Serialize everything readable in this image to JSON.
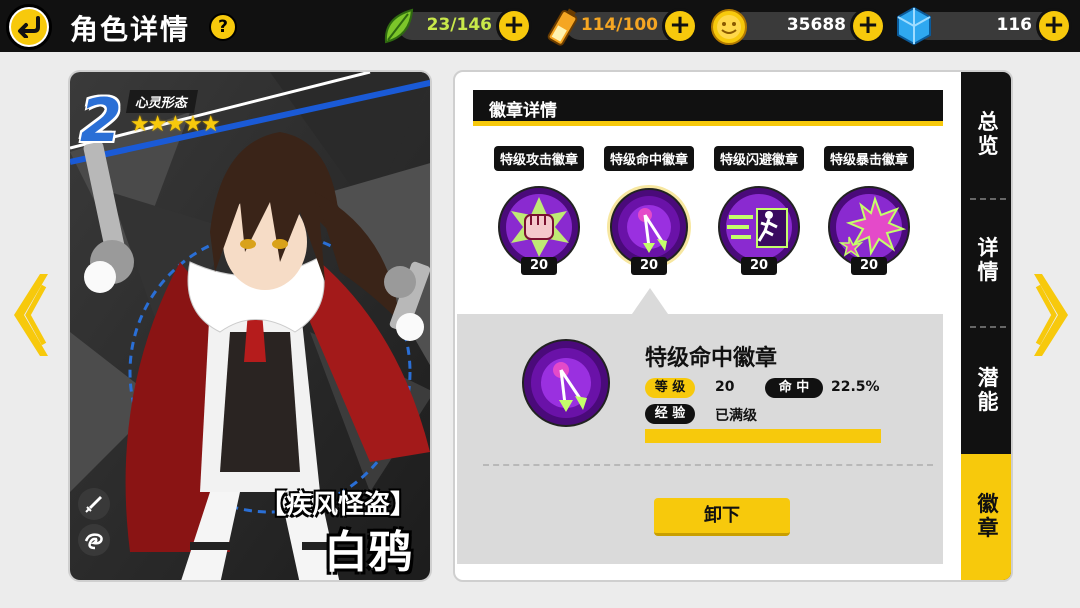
{
  "header": {
    "title": "角色详情",
    "help_label": "?",
    "resources": [
      {
        "icon": "leaf-icon",
        "value": "23/146",
        "value_color": "#c9e84a"
      },
      {
        "icon": "battery-icon",
        "value": "114/100",
        "value_color": "#f5a623"
      },
      {
        "icon": "coin-icon",
        "value": "35688",
        "value_color": "#ffffff"
      },
      {
        "icon": "crystal-icon",
        "value": "116",
        "value_color": "#ffffff"
      }
    ],
    "plus_label": "+"
  },
  "character": {
    "rank": "2",
    "form_label": "心灵形态",
    "stars": "★★★★★",
    "star_count": 5,
    "title": "【疾风怪盗】",
    "name": "白鸦"
  },
  "badge_panel": {
    "header": "徽章详情",
    "badges": [
      {
        "label": "特级攻击徽章",
        "level": "20",
        "icon": "fist-icon"
      },
      {
        "label": "特级命中徽章",
        "level": "20",
        "icon": "target-arrow-icon",
        "selected": true
      },
      {
        "label": "特级闪避徽章",
        "level": "20",
        "icon": "running-man-icon"
      },
      {
        "label": "特级暴击徽章",
        "level": "20",
        "icon": "burst-icon"
      }
    ],
    "detail": {
      "name": "特级命中徽章",
      "level_label": "等 级",
      "level_value": "20",
      "stat_label": "命 中",
      "stat_value": "22.5%",
      "exp_label": "经 验",
      "exp_value": "已满级",
      "exp_progress": 1.0
    },
    "unequip_label": "卸下"
  },
  "side_tabs": [
    {
      "label": "总览",
      "active": false
    },
    {
      "label": "详情",
      "active": false
    },
    {
      "label": "潜能",
      "active": false
    },
    {
      "label": "徽章",
      "active": true
    }
  ],
  "colors": {
    "accent": "#f7c90c",
    "dark": "#111111",
    "badge_purple": "#7a1fb8"
  }
}
